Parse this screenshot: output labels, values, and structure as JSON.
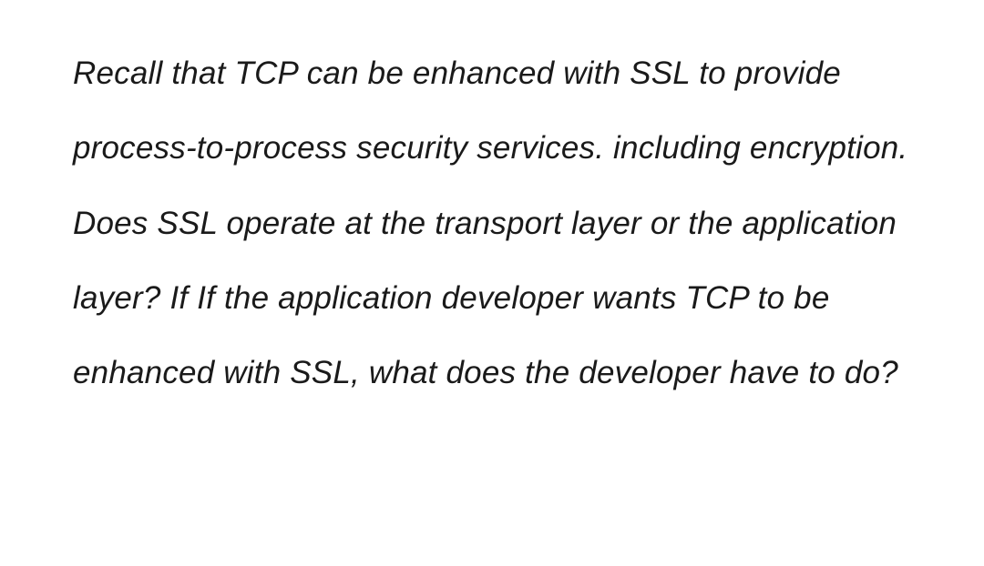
{
  "question": {
    "text": "Recall that TCP can be enhanced with SSL to provide process-to-process security services. including encryption. Does SSL operate at the transport layer or the application layer? If If the application developer wants TCP to be enhanced with SSL, what does the developer have to do?"
  }
}
